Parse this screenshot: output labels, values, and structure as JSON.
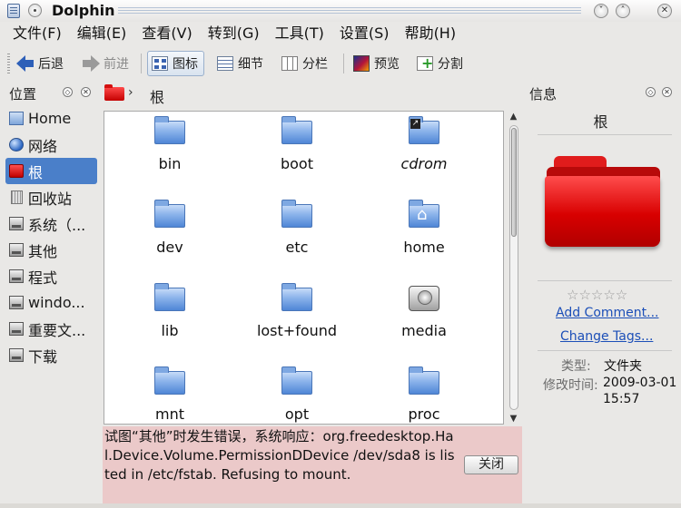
{
  "window": {
    "title": "Dolphin"
  },
  "menubar": {
    "items": [
      "文件(F)",
      "编辑(E)",
      "查看(V)",
      "转到(G)",
      "工具(T)",
      "设置(S)",
      "帮助(H)"
    ]
  },
  "toolbar": {
    "back_label": "后退",
    "forward_label": "前进",
    "icons_label": "图标",
    "details_label": "细节",
    "columns_label": "分栏",
    "preview_label": "预览",
    "split_label": "分割"
  },
  "places": {
    "title": "位置",
    "items": [
      {
        "label": "Home",
        "icon": "home-folder-icon"
      },
      {
        "label": "网络",
        "icon": "network-globe-icon"
      },
      {
        "label": "根",
        "icon": "root-folder-icon"
      },
      {
        "label": "回收站",
        "icon": "trash-icon"
      },
      {
        "label": "系统（...",
        "icon": "drive-icon"
      },
      {
        "label": "其他",
        "icon": "drive-icon"
      },
      {
        "label": "程式",
        "icon": "drive-icon"
      },
      {
        "label": "windo...",
        "icon": "drive-icon"
      },
      {
        "label": "重要文...",
        "icon": "drive-icon"
      },
      {
        "label": "下载",
        "icon": "drive-icon"
      }
    ],
    "selected_index": 2
  },
  "breadcrumb": {
    "label": "根"
  },
  "files": [
    {
      "name": "bin",
      "icon": "folder-icon"
    },
    {
      "name": "boot",
      "icon": "folder-icon"
    },
    {
      "name": "cdrom",
      "icon": "folder-link-icon"
    },
    {
      "name": "dev",
      "icon": "folder-icon"
    },
    {
      "name": "etc",
      "icon": "folder-icon"
    },
    {
      "name": "home",
      "icon": "folder-home-icon"
    },
    {
      "name": "lib",
      "icon": "folder-icon"
    },
    {
      "name": "lost+found",
      "icon": "folder-icon"
    },
    {
      "name": "media",
      "icon": "drive-icon"
    },
    {
      "name": "mnt",
      "icon": "folder-icon"
    },
    {
      "name": "opt",
      "icon": "folder-icon"
    },
    {
      "name": "proc",
      "icon": "folder-icon"
    }
  ],
  "error": {
    "message": "试图“其他”时发生错误，系统响应：org.freedesktop.Hal.Device.Volume.PermissionDDevice /dev/sda8 is listed in /etc/fstab. Refusing to mount.",
    "close_label": "关闭"
  },
  "info": {
    "title": "信息",
    "name": "根",
    "stars": "☆☆☆☆☆",
    "add_comment": "Add Comment...",
    "change_tags": "Change Tags...",
    "type_label": "类型:",
    "type_value": "文件夹",
    "modified_label": "修改时间:",
    "modified_date": "2009-03-01",
    "modified_time": "15:57"
  },
  "colors": {
    "selection": "#4a7fc9",
    "error_background": "#ebc9c9",
    "root_folder": "#e01c1c",
    "link": "#1c4fb8"
  }
}
